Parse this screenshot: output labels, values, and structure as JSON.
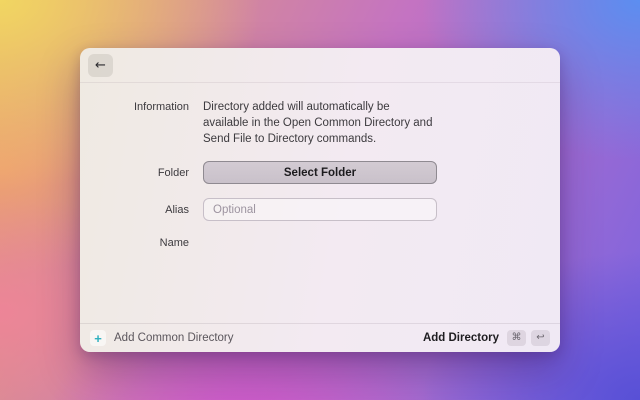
{
  "colors": {
    "accent_teal": "#2fb0bf",
    "button_face": "#cdc5cd",
    "window_bg_left": "#efeae2",
    "window_bg_right": "#f2e9f3",
    "bg_gradient": [
      "#f1d662",
      "#5c8ef0",
      "#5850d6",
      "#ce54ca",
      "#ee8498",
      "#f0a270"
    ]
  },
  "header": {
    "back_icon": "←"
  },
  "form": {
    "information": {
      "label": "Information",
      "text": "Directory added will automatically be available in the Open Common Directory and Send File to Directory commands."
    },
    "folder": {
      "label": "Folder",
      "button": "Select Folder"
    },
    "alias": {
      "label": "Alias",
      "placeholder": "Optional",
      "value": ""
    },
    "name": {
      "label": "Name",
      "value": ""
    }
  },
  "footer": {
    "add_common": {
      "icon": "+",
      "label": "Add Common Directory"
    },
    "add_directory": {
      "label": "Add Directory",
      "shortcut_keys": [
        "⌘",
        "↩"
      ]
    }
  }
}
